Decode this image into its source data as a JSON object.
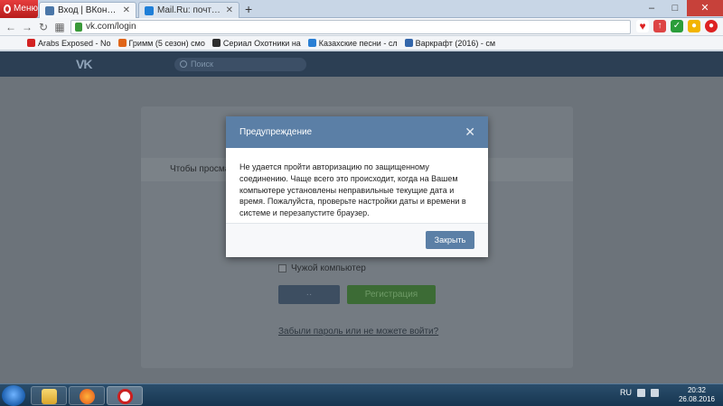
{
  "browser": {
    "menu_label": "Меню",
    "tabs": [
      {
        "title": "Вход | ВКонтакте",
        "active": true
      },
      {
        "title": "Mail.Ru: почта, поиск в и",
        "active": false
      }
    ],
    "new_tab_symbol": "+",
    "window_controls": {
      "minimize": "–",
      "maximize": "□",
      "close": "✕"
    },
    "url": "vk.com/login",
    "bookmarks": [
      {
        "label": "Arabs Exposed - No",
        "color": "#d32222"
      },
      {
        "label": "Гримм (5 сезон) смо",
        "color": "#e0661a"
      },
      {
        "label": "Сериал Охотники на",
        "color": "#2e2e2e"
      },
      {
        "label": "Казахские песни - сл",
        "color": "#2a7fd4"
      },
      {
        "label": "Варкрафт (2016) - см",
        "color": "#3366aa"
      }
    ]
  },
  "vk": {
    "logo": "VK",
    "search_placeholder": "Поиск",
    "notice_text": "Чтобы просмат",
    "foreign_computer": "Чужой компьютер",
    "login_button": "··",
    "register_button": "Регистрация",
    "forgot_link": "Забыли пароль или не можете войти?"
  },
  "modal": {
    "title": "Предупреждение",
    "close_symbol": "✕",
    "message": "Не удается пройти авторизацию по защищенному соединению. Чаще всего это происходит, когда на Вашем компьютере установлены неправильные текущие дата и время. Пожалуйста, проверьте настройки даты и времени в системе и перезапустите браузер.",
    "button": "Закрыть"
  },
  "taskbar": {
    "language": "RU",
    "time": "20:32",
    "date": "26.08.2016"
  },
  "colors": {
    "vk_header": "#2c3f54",
    "modal_header": "#5b7fa6",
    "opera_red": "#cc1f1f"
  }
}
